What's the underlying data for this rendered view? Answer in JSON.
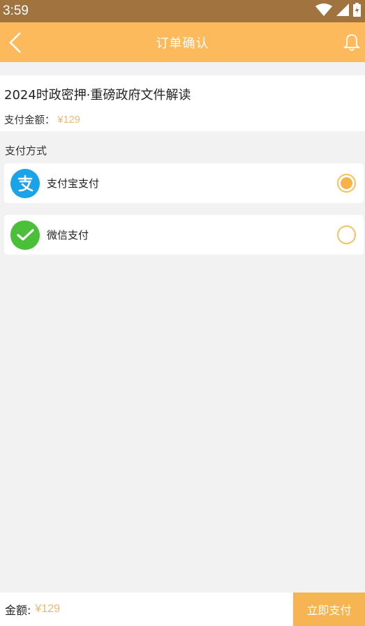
{
  "status_bar": {
    "time": "3:59",
    "icons": [
      "wifi-icon",
      "signal-icon",
      "battery-icon"
    ]
  },
  "header": {
    "title": "订单确认",
    "left_icon": "back-arrow-icon",
    "right_icon": "bell-icon"
  },
  "product": {
    "title": "2024时政密押·重磅政府文件解读",
    "amount_label": "支付金额：",
    "amount_value": "¥129"
  },
  "payment": {
    "section_label": "支付方式",
    "options": [
      {
        "label": "支付宝支付",
        "icon": "alipay-icon",
        "selected": true
      },
      {
        "label": "微信支付",
        "icon": "wechat-pay-icon",
        "selected": false
      }
    ]
  },
  "footer": {
    "total_label": "金额:",
    "total_value": "¥129",
    "pay_button_label": "立即支付"
  },
  "colors": {
    "status_bar": "#a0733f",
    "header": "#fdba5c",
    "accent": "#f6b552",
    "price": "#e8b96f",
    "alipay": "#1aa3e8",
    "wechat": "#4cbf3a"
  }
}
